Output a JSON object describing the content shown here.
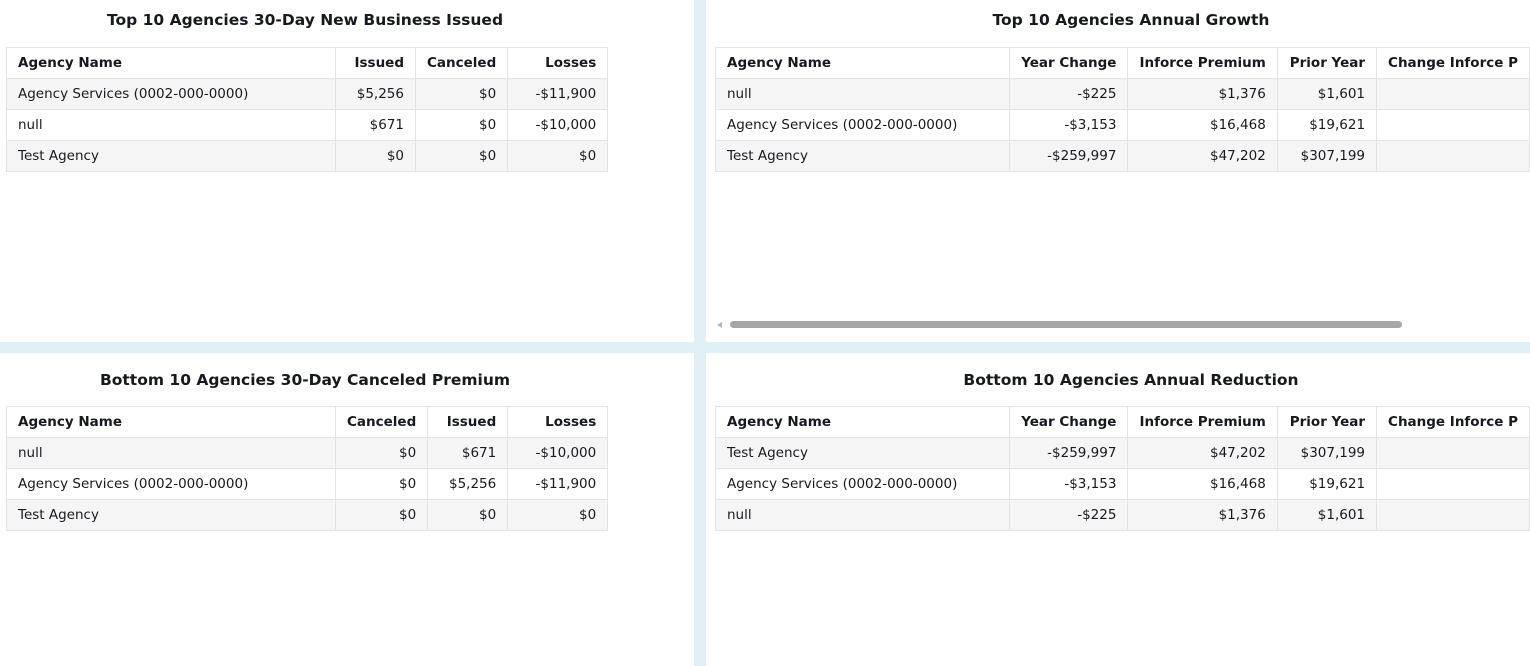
{
  "top_new_business": {
    "title": "Top 10 Agencies 30-Day New Business Issued",
    "columns": [
      "Agency Name",
      "Issued",
      "Canceled",
      "Losses"
    ],
    "rows": [
      [
        "Agency Services (0002-000-0000)",
        "$5,256",
        "$0",
        "-$11,900"
      ],
      [
        "null",
        "$671",
        "$0",
        "-$10,000"
      ],
      [
        "Test Agency",
        "$0",
        "$0",
        "$0"
      ]
    ]
  },
  "top_annual_growth": {
    "title": "Top 10 Agencies Annual Growth",
    "columns": [
      "Agency Name",
      "Year Change",
      "Inforce Premium",
      "Prior Year",
      "Change Inforce P"
    ],
    "rows": [
      [
        "null",
        "-$225",
        "$1,376",
        "$1,601",
        ""
      ],
      [
        "Agency Services (0002-000-0000)",
        "-$3,153",
        "$16,468",
        "$19,621",
        ""
      ],
      [
        "Test Agency",
        "-$259,997",
        "$47,202",
        "$307,199",
        ""
      ]
    ]
  },
  "bottom_canceled": {
    "title": "Bottom 10 Agencies 30-Day Canceled Premium",
    "columns": [
      "Agency Name",
      "Canceled",
      "Issued",
      "Losses"
    ],
    "rows": [
      [
        "null",
        "$0",
        "$671",
        "-$10,000"
      ],
      [
        "Agency Services (0002-000-0000)",
        "$0",
        "$5,256",
        "-$11,900"
      ],
      [
        "Test Agency",
        "$0",
        "$0",
        "$0"
      ]
    ]
  },
  "bottom_annual_reduction": {
    "title": "Bottom 10 Agencies Annual Reduction",
    "columns": [
      "Agency Name",
      "Year Change",
      "Inforce Premium",
      "Prior Year",
      "Change Inforce P"
    ],
    "rows": [
      [
        "Test Agency",
        "-$259,997",
        "$47,202",
        "$307,199",
        ""
      ],
      [
        "Agency Services (0002-000-0000)",
        "-$3,153",
        "$16,468",
        "$19,621",
        ""
      ],
      [
        "null",
        "-$225",
        "$1,376",
        "$1,601",
        ""
      ]
    ]
  }
}
